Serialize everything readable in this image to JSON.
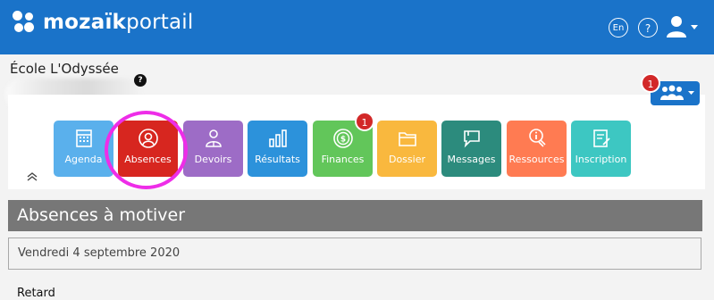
{
  "header": {
    "brand_bold": "mozaïk",
    "brand_light": "portail",
    "lang_label": "En",
    "help_label": "?",
    "accent": "#1a73c9"
  },
  "school": {
    "name": "École L'Odyssée",
    "help_badge": "?"
  },
  "role_switch": {
    "badge": "1",
    "icon": "people-icon"
  },
  "tiles": [
    {
      "label": "Agenda",
      "color": "#5ab0ec",
      "icon": "calendar-icon"
    },
    {
      "label": "Absences",
      "color": "#d7261f",
      "icon": "person-circle-icon"
    },
    {
      "label": "Devoirs",
      "color": "#9d6cc6",
      "icon": "person-book-icon"
    },
    {
      "label": "Résultats",
      "color": "#2c92db",
      "icon": "bar-chart-icon"
    },
    {
      "label": "Finances",
      "color": "#62c65a",
      "icon": "coin-icon",
      "badge": "1"
    },
    {
      "label": "Dossier",
      "color": "#f9b83e",
      "icon": "folder-icon"
    },
    {
      "label": "Messages",
      "color": "#2c8b7d",
      "icon": "message-icon"
    },
    {
      "label": "Ressources",
      "color": "#ff7b52",
      "icon": "hand-info-icon"
    },
    {
      "label": "Inscription",
      "color": "#3dc7c2",
      "icon": "form-icon"
    }
  ],
  "section": {
    "title": "Absences à motiver",
    "date": "Vendredi 4 septembre 2020",
    "item": "Retard"
  }
}
